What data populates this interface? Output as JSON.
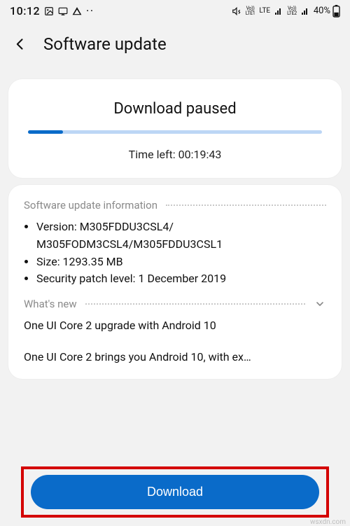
{
  "statusbar": {
    "time": "10:12",
    "battery_pct": "40%",
    "vo1_top": "Vo))",
    "vo1_bot": "LTE1",
    "lte": "LTE",
    "vo2_top": "Vo))",
    "vo2_bot": "LTE2"
  },
  "appbar": {
    "title": "Software update"
  },
  "status": {
    "heading": "Download paused",
    "progress_pct": 12,
    "time_left": "Time left: 00:19:43"
  },
  "info": {
    "section_label": "Software update information",
    "version_label": "Version:",
    "version_line1": "M305FDDU3CSL4/",
    "version_line2": "M305FODM3CSL4/M305FDDU3CSL1",
    "size_label": "Size:",
    "size_value": "1293.35 MB",
    "patch_label": "Security patch level:",
    "patch_value": "1 December 2019"
  },
  "whatsnew": {
    "label": "What's new",
    "line1": "One UI Core 2 upgrade with Android 10",
    "line2": "One UI Core 2 brings you Android 10, with ex…"
  },
  "download_button": "Download",
  "watermark": "wsxdn.com"
}
